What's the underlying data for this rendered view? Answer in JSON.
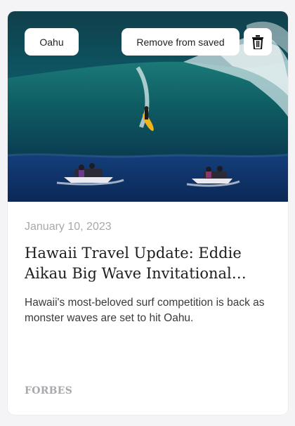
{
  "card": {
    "tag": "Oahu",
    "remove_label": "Remove from saved",
    "date": "January 10, 2023",
    "title": "Hawaii Travel Update: Eddie Aikau Big Wave Invitational…",
    "summary": "Hawaii's most-beloved surf competition is back as monster waves are set to hit Oahu.",
    "source": "FORBES",
    "image_alt": "Surfer riding a giant wave with jet skis in the foreground"
  },
  "icons": {
    "trash": "trash-icon"
  }
}
